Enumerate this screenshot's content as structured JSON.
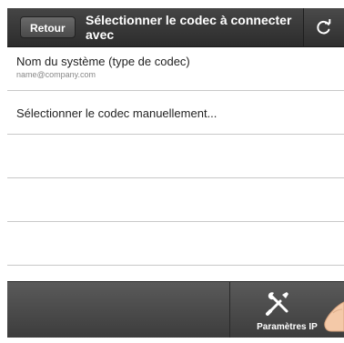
{
  "header": {
    "back_label": "Retour",
    "title": "Sélectionner le codec à connecter avec",
    "refresh_icon": "refresh-icon"
  },
  "list": {
    "items": [
      {
        "title": "Nom du système (type de codec)",
        "subtitle": "name@company.com"
      },
      {
        "title": "Sélectionner le codec manuellement..."
      }
    ]
  },
  "footer": {
    "ip_settings_label": "Paramètres IP",
    "ip_settings_icon": "tools-icon"
  },
  "colors": {
    "header_bg": "#333333",
    "footer_bg": "#4a4a4a",
    "divider": "#c8c8c8"
  }
}
